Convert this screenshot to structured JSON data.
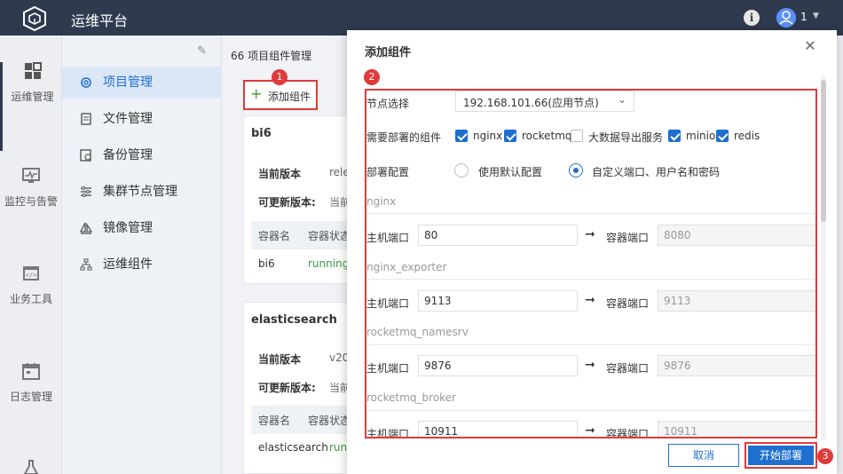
{
  "app": {
    "title": "运维平台",
    "user_num": "1"
  },
  "rail": [
    {
      "label": "运维管理",
      "icon": "dashboard-icon"
    },
    {
      "label": "监控与告警",
      "icon": "monitor-icon"
    },
    {
      "label": "业务工具",
      "icon": "code-window-icon"
    },
    {
      "label": "日志管理",
      "icon": "calendar-icon"
    }
  ],
  "subnav": [
    {
      "label": "项目管理",
      "icon": "gear-icon"
    },
    {
      "label": "文件管理",
      "icon": "file-icon"
    },
    {
      "label": "备份管理",
      "icon": "backup-icon"
    },
    {
      "label": "集群节点管理",
      "icon": "sliders-icon"
    },
    {
      "label": "镜像管理",
      "icon": "sail-icon"
    },
    {
      "label": "运维组件",
      "icon": "tree-icon"
    }
  ],
  "main": {
    "breadcrumb": "66 项目组件管理",
    "add_label": "添加组件",
    "cards": [
      {
        "title": "bi6",
        "current_label": "当前版本",
        "current_val": "rele",
        "update_label": "可更新版本:",
        "update_val": "当前",
        "col1": "容器名",
        "col2": "容器状态",
        "name": "bi6",
        "status": "running"
      },
      {
        "title": "elasticsearch",
        "current_label": "当前版本",
        "current_val": "v20",
        "update_label": "可更新版本:",
        "update_val": "当前",
        "col1": "容器名",
        "col2": "容器状态",
        "name": "elasticsearch",
        "status": "running"
      }
    ]
  },
  "modal": {
    "title": "添加组件",
    "node_label": "节点选择",
    "node_value": "192.168.101.66(应用节点)",
    "components_label": "需要部署的组件",
    "components": [
      {
        "label": "nginx",
        "checked": true
      },
      {
        "label": "rocketmq",
        "checked": true
      },
      {
        "label": "大数据导出服务",
        "checked": false
      },
      {
        "label": "minio",
        "checked": true
      },
      {
        "label": "redis",
        "checked": true
      }
    ],
    "config_label": "部署配置",
    "config_options": [
      {
        "label": "使用默认配置",
        "selected": false
      },
      {
        "label": "自定义端口、用户名和密码",
        "selected": true
      }
    ],
    "host_port_label": "主机端口",
    "container_port_label": "容器端口",
    "sections": [
      {
        "name": "nginx",
        "host": "80",
        "container": "8080"
      },
      {
        "name": "nginx_exporter",
        "host": "9113",
        "container": "9113"
      },
      {
        "name": "rocketmq_namesrv",
        "host": "9876",
        "container": "9876"
      },
      {
        "name": "rocketmq_broker",
        "host": "10911",
        "container": "10911"
      }
    ],
    "cancel_label": "取消",
    "deploy_label": "开始部署"
  },
  "badges": [
    "1",
    "2",
    "3"
  ]
}
